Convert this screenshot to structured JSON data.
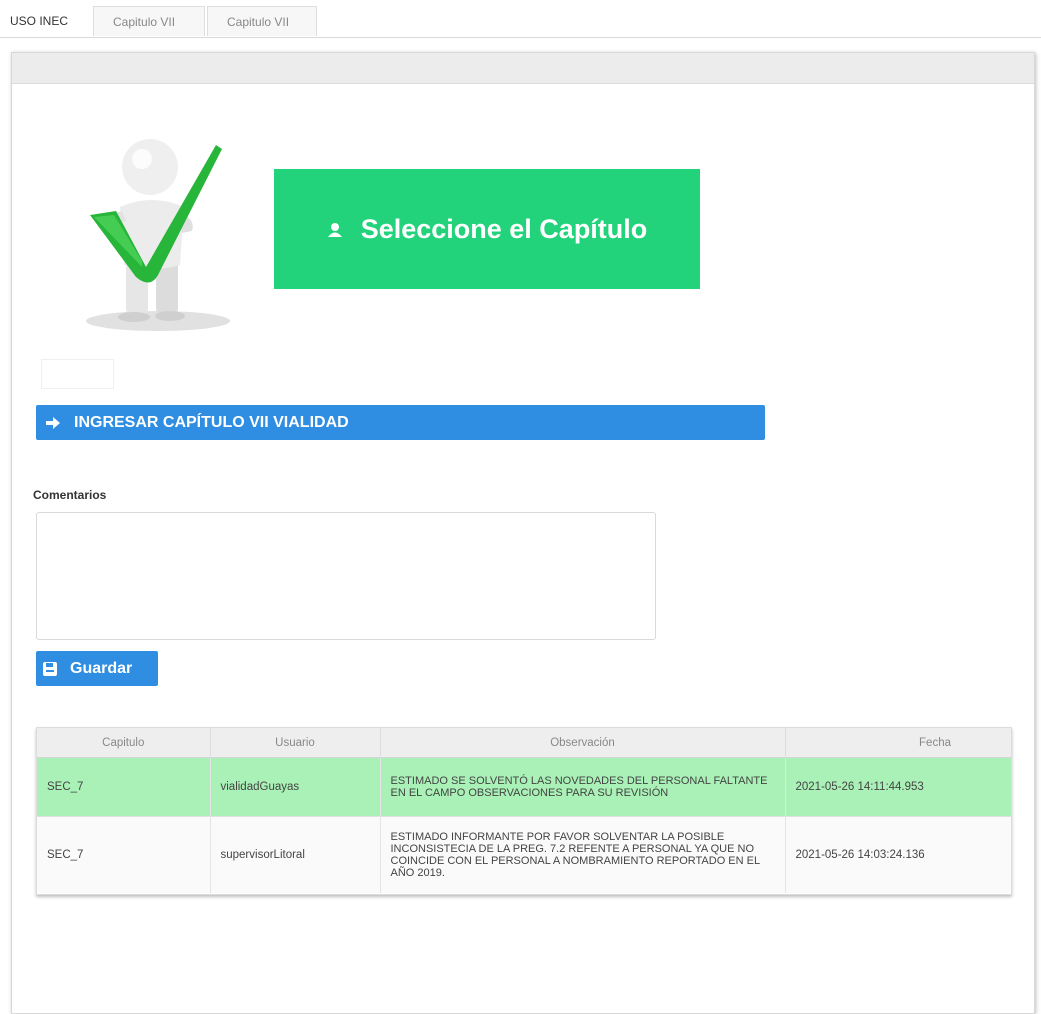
{
  "tabs": [
    {
      "label": "USO INEC"
    },
    {
      "label": "Capitulo VII"
    },
    {
      "label": "Capitulo VII"
    }
  ],
  "banner": {
    "text": "Seleccione el Capítulo",
    "icon": "user-icon",
    "color": "#22d37b"
  },
  "ingresar_button": {
    "label": "INGRESAR CAPÍTULO VII VIALIDAD",
    "icon": "arrow-right-icon"
  },
  "comentarios": {
    "label": "Comentarios",
    "value": ""
  },
  "guardar_button": {
    "label": "Guardar",
    "icon": "save-icon"
  },
  "table": {
    "headers": [
      "Capitulo",
      "Usuario",
      "Observación",
      "Fecha"
    ],
    "rows": [
      {
        "capitulo": "SEC_7",
        "usuario": "vialidadGuayas",
        "observacion": "ESTIMADO SE SOLVENTÓ LAS NOVEDADES DEL PERSONAL FALTANTE EN EL CAMPO OBSERVACIONES PARA SU REVISIÓN",
        "fecha": "2021-05-26 14:11:44.953"
      },
      {
        "capitulo": "SEC_7",
        "usuario": "supervisorLitoral",
        "observacion": "ESTIMADO INFORMANTE POR FAVOR SOLVENTAR LA POSIBLE INCONSISTECIA DE LA PREG. 7.2 REFENTE A PERSONAL YA QUE NO COINCIDE CON EL PERSONAL A NOMBRAMIENTO REPORTADO EN EL AÑO 2019.",
        "fecha": "2021-05-26 14:03:24.136"
      }
    ]
  },
  "colors": {
    "primary": "#2f8de2",
    "success": "#22d37b",
    "highlight_row": "#a9f1b6"
  }
}
